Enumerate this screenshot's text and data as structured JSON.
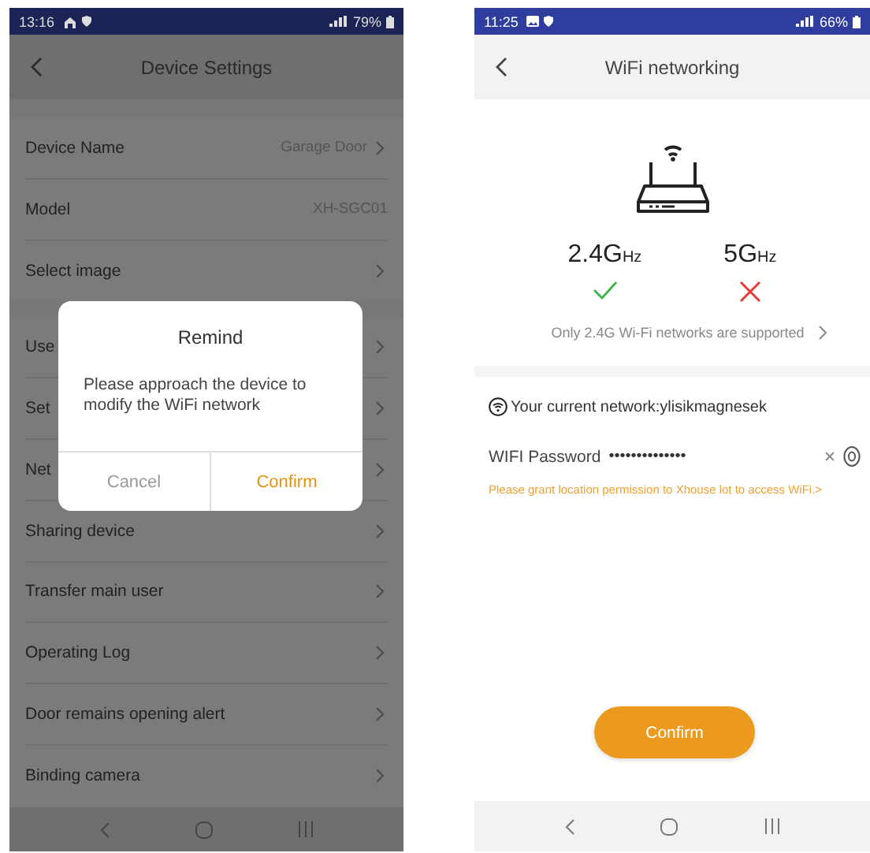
{
  "left_screen": {
    "status_bar": {
      "time": "13:16",
      "battery": "79%"
    },
    "header": {
      "title": "Device Settings"
    },
    "settings_groups": [
      [
        {
          "label": "Device Name",
          "value": "Garage Door",
          "chevron": true
        },
        {
          "label": "Model",
          "value": "XH-SGC01",
          "chevron": false
        },
        {
          "label": "Select image",
          "chevron": true
        }
      ],
      [
        {
          "label": "Use",
          "chevron": true
        },
        {
          "label": "Set",
          "chevron": true
        },
        {
          "label": "Net",
          "chevron": true
        },
        {
          "label": "Sharing device",
          "chevron": true
        },
        {
          "label": "Transfer main user",
          "chevron": true
        },
        {
          "label": "Operating Log",
          "chevron": true
        },
        {
          "label": "Door remains opening alert",
          "chevron": true
        },
        {
          "label": "Binding camera",
          "chevron": true
        }
      ]
    ],
    "dialog": {
      "title": "Remind",
      "message": "Please approach the device to modify the WiFi network",
      "buttons": [
        {
          "label": "Cancel",
          "kind": "secondary"
        },
        {
          "label": "Confirm",
          "kind": "primary"
        }
      ]
    }
  },
  "right_screen": {
    "status_bar": {
      "time": "11:25",
      "battery": "66%"
    },
    "header": {
      "title": "WiFi networking"
    },
    "bands": [
      {
        "name": "2.4G",
        "unit": "Hz",
        "supported": true
      },
      {
        "name": "5G",
        "unit": "Hz",
        "supported": false
      }
    ],
    "note": "Only 2.4G Wi-Fi networks are supported",
    "current_network": "Your current network:ylisikmagnesek",
    "password": {
      "label": "WIFI Password",
      "value": "••••••••••••••"
    },
    "permission_hint": "Please grant location permission to Xhouse lot to access WiFi.>",
    "confirm_button": "Confirm"
  }
}
